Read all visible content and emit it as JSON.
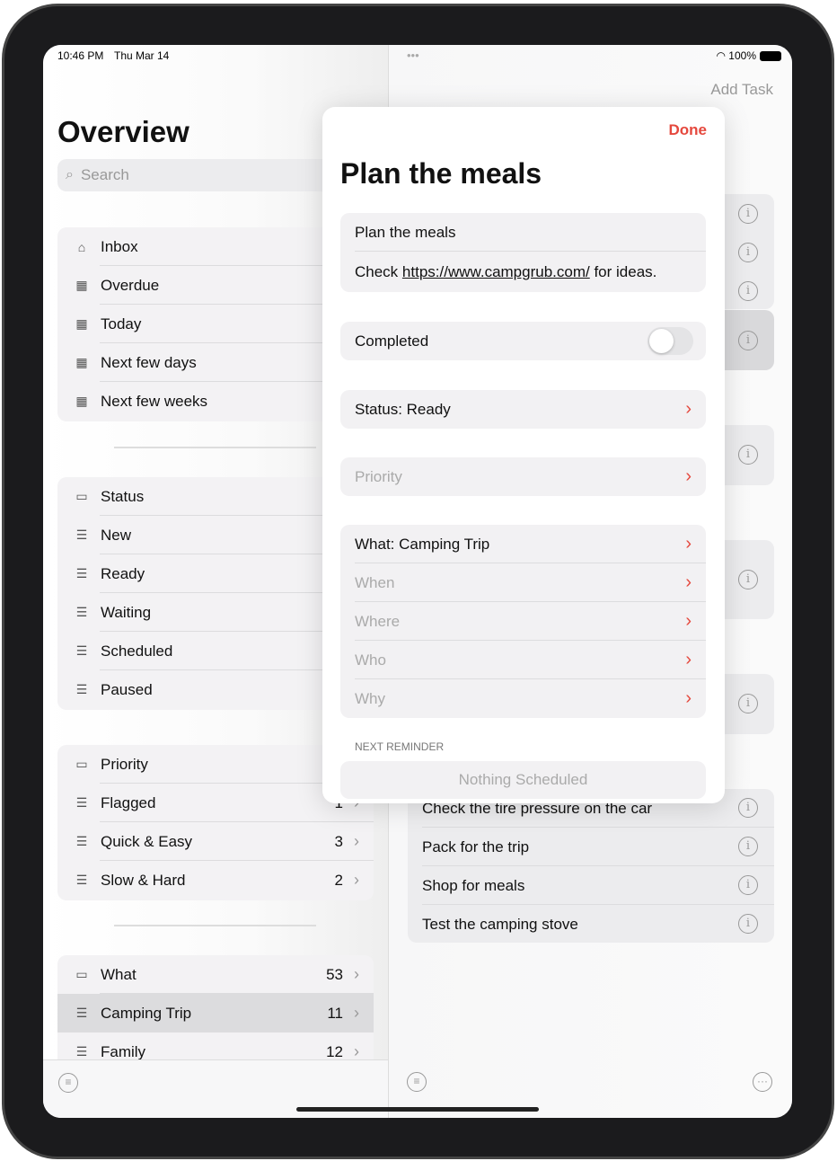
{
  "status_bar": {
    "time": "10:46 PM",
    "date": "Thu Mar 14",
    "battery": "100%",
    "multitask": "•••"
  },
  "sidebar": {
    "title": "Overview",
    "search_placeholder": "Search",
    "groups": [
      {
        "items": [
          {
            "label": "Inbox",
            "icon": "tray-icon"
          },
          {
            "label": "Overdue",
            "icon": "calendar-icon"
          },
          {
            "label": "Today",
            "icon": "calendar-icon"
          },
          {
            "label": "Next few days",
            "icon": "calendar-icon"
          },
          {
            "label": "Next few weeks",
            "icon": "calendar-icon"
          }
        ]
      },
      {
        "items": [
          {
            "label": "Status",
            "icon": "folder-icon"
          },
          {
            "label": "New",
            "icon": "list-icon"
          },
          {
            "label": "Ready",
            "icon": "list-icon"
          },
          {
            "label": "Waiting",
            "icon": "list-icon"
          },
          {
            "label": "Scheduled",
            "icon": "list-icon"
          },
          {
            "label": "Paused",
            "icon": "list-icon"
          }
        ]
      },
      {
        "items": [
          {
            "label": "Priority",
            "icon": "folder-icon"
          },
          {
            "label": "Flagged",
            "icon": "list-icon",
            "count": "1"
          },
          {
            "label": "Quick & Easy",
            "icon": "list-icon",
            "count": "3"
          },
          {
            "label": "Slow & Hard",
            "icon": "list-icon",
            "count": "2"
          }
        ]
      },
      {
        "items": [
          {
            "label": "What",
            "icon": "folder-icon",
            "count": "53"
          },
          {
            "label": "Camping Trip",
            "icon": "list-icon",
            "count": "11",
            "selected": true
          },
          {
            "label": "Family",
            "icon": "list-icon",
            "count": "12"
          }
        ]
      }
    ]
  },
  "detail": {
    "add_task": "Add Task",
    "tasks": [
      "Check the tire pressure on the car",
      "Pack for the trip",
      "Shop for meals",
      "Test the camping stove"
    ]
  },
  "modal": {
    "done": "Done",
    "title": "Plan the meals",
    "name_field": "Plan the meals",
    "notes_prefix": "Check ",
    "notes_link": "https://www.campgrub.com/",
    "notes_suffix": " for ideas.",
    "completed_label": "Completed",
    "completed": false,
    "status": "Status: Ready",
    "priority": "Priority",
    "what": "What: Camping Trip",
    "when": "When",
    "where": "Where",
    "who": "Who",
    "why": "Why",
    "reminder_header": "NEXT REMINDER",
    "reminder_button": "Nothing Scheduled"
  },
  "colors": {
    "accent": "#e5483d"
  }
}
